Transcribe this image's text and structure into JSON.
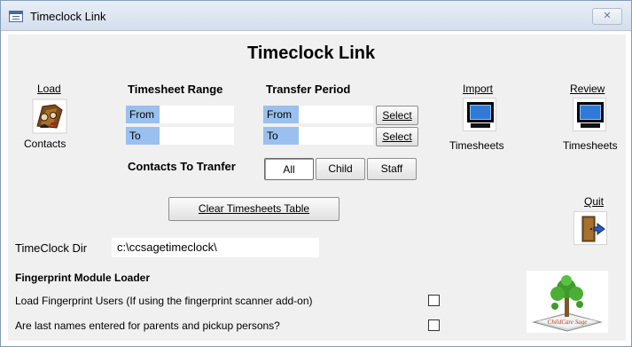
{
  "window": {
    "title": "Timeclock Link",
    "close_glyph": "✕"
  },
  "header": {
    "heading": "Timeclock Link"
  },
  "load": {
    "label": "Load",
    "sublabel": "Contacts"
  },
  "timesheet_range": {
    "label": "Timesheet Range",
    "from_label": "From",
    "from_value": "",
    "to_label": "To",
    "to_value": ""
  },
  "transfer_period": {
    "label": "Transfer Period",
    "from_label": "From",
    "from_value": "",
    "to_label": "To",
    "to_value": "",
    "select_from_label": "Select",
    "select_to_label": "Select"
  },
  "import": {
    "label": "Import",
    "sublabel": "Timesheets"
  },
  "review": {
    "label": "Review",
    "sublabel": "Timesheets"
  },
  "contacts_to_transfer": {
    "label": "Contacts To Tranfer",
    "options": [
      "All",
      "Child",
      "Staff"
    ],
    "selected": "All"
  },
  "clear_button": {
    "label": "Clear Timesheets Table"
  },
  "quit": {
    "label": "Quit"
  },
  "timeclock_dir": {
    "label": "TimeClock Dir",
    "value": "c:\\ccsagetimeclock\\"
  },
  "fingerprint": {
    "section_title": "Fingerprint Module Loader",
    "load_users_label": "Load Fingerprint Users (If using the fingerprint scanner add-on)",
    "load_users_checked": false,
    "last_names_label": "Are last names entered for parents and pickup persons?",
    "last_names_checked": false
  },
  "logo": {
    "text": "ChildCare Sage"
  },
  "colors": {
    "field_label_bg": "#99c0ee",
    "form_bg": "#f0f0f0",
    "window_border": "#7f9db9"
  }
}
